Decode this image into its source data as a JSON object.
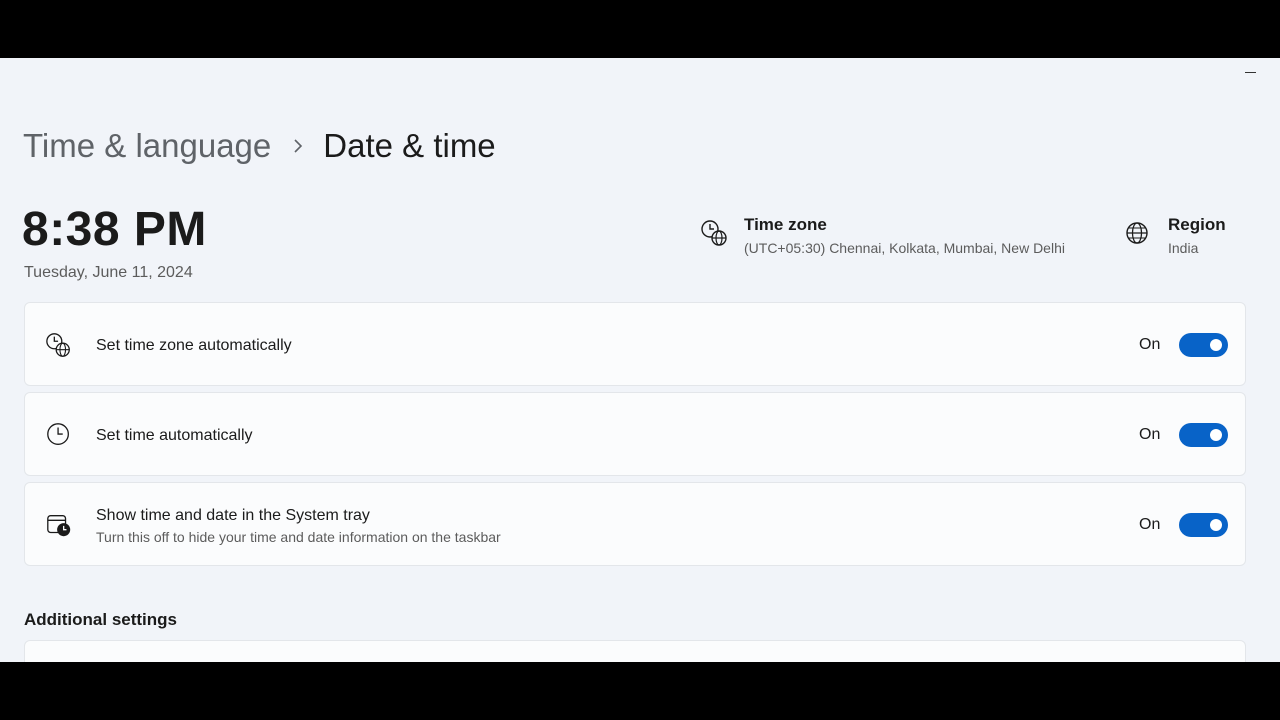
{
  "window": {
    "minimize_icon": "minimize-icon"
  },
  "breadcrumb": {
    "parent": "Time & language",
    "separator_icon": "chevron-right-icon",
    "current": "Date & time"
  },
  "clock": {
    "time": "8:38 PM",
    "date": "Tuesday, June 11, 2024"
  },
  "time_zone": {
    "icon": "time-zone-icon",
    "title": "Time zone",
    "value": "(UTC+05:30) Chennai, Kolkata, Mumbai, New Delhi"
  },
  "region": {
    "icon": "globe-icon",
    "title": "Region",
    "value": "India"
  },
  "settings": [
    {
      "icon": "time-zone-icon",
      "label": "Set time zone automatically",
      "description": "",
      "state": "On",
      "toggle_on": true
    },
    {
      "icon": "clock-icon",
      "label": "Set time automatically",
      "description": "",
      "state": "On",
      "toggle_on": true
    },
    {
      "icon": "calendar-clock-icon",
      "label": "Show time and date in the System tray",
      "description": "Turn this off to hide your time and date information on the taskbar",
      "state": "On",
      "toggle_on": true
    }
  ],
  "additional": {
    "title": "Additional settings"
  },
  "colors": {
    "accent": "#0863c8",
    "background": "#f1f4f9",
    "card": "#fbfcfd"
  }
}
